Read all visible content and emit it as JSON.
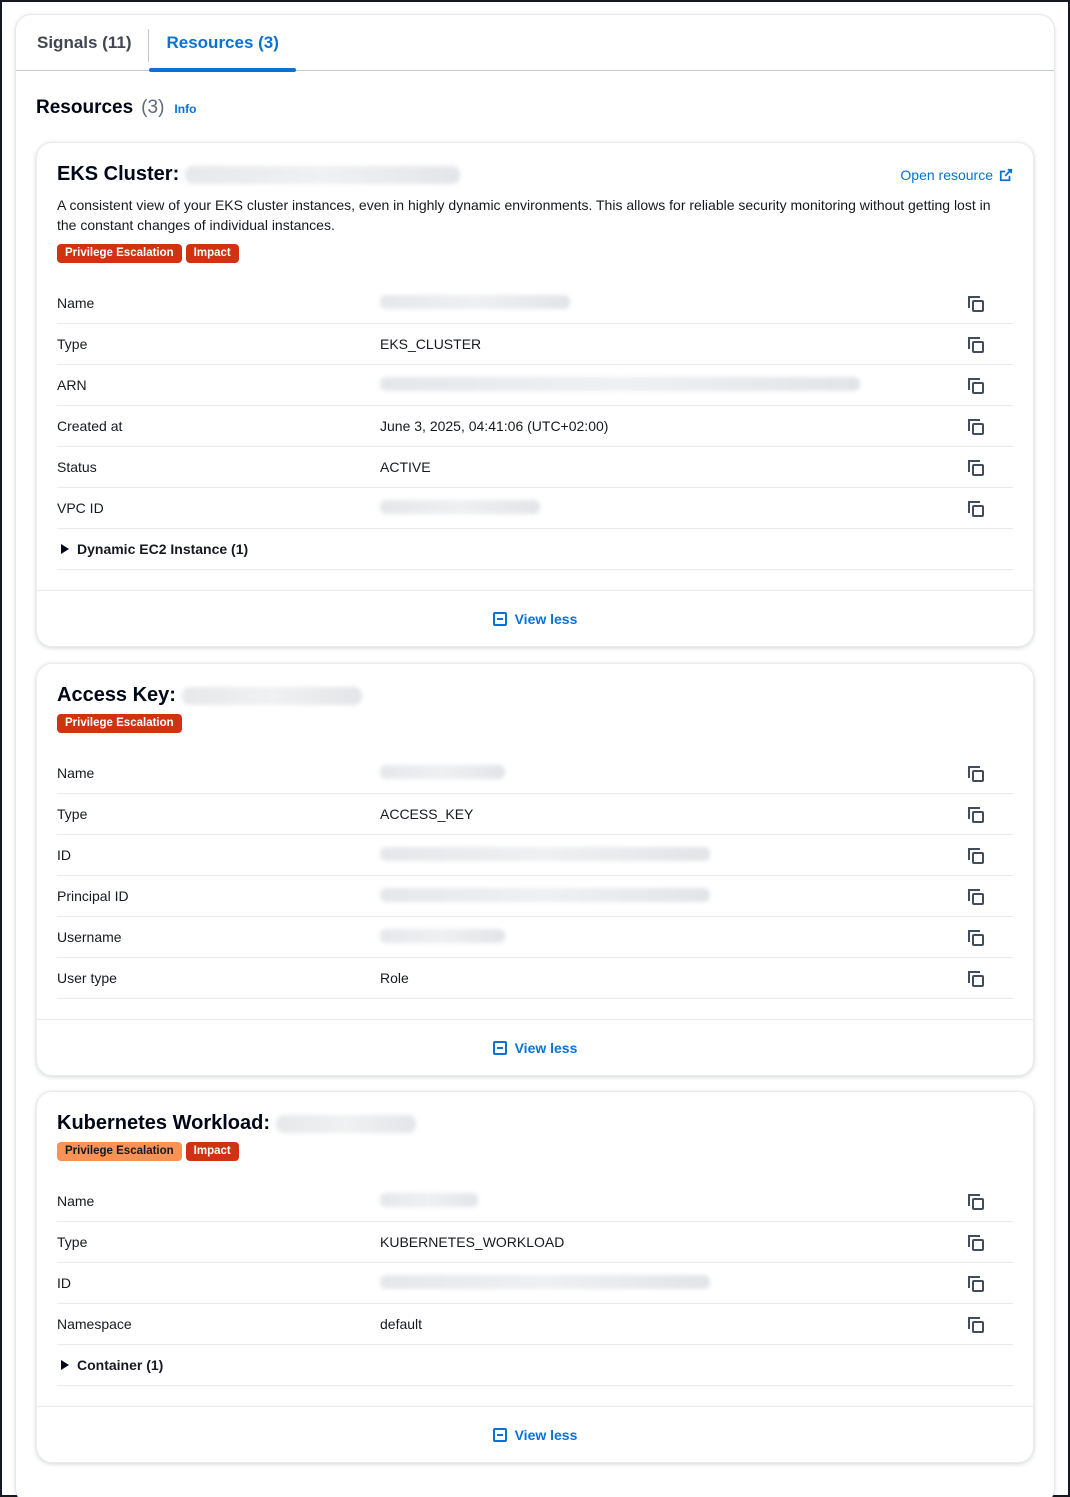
{
  "tabs": [
    {
      "label": "Signals (11)"
    },
    {
      "label": "Resources (3)"
    }
  ],
  "section": {
    "title": "Resources",
    "count": "(3)",
    "info": "Info"
  },
  "resources": [
    {
      "title": "EKS Cluster:",
      "open_link": "Open resource",
      "description": "A consistent view of your EKS cluster instances, even in highly dynamic environments. This allows for reliable security monitoring without getting lost in the constant changes of individual instances.",
      "badges": [
        "Privilege Escalation",
        "Impact"
      ],
      "fields": [
        {
          "key": "Name",
          "value": ""
        },
        {
          "key": "Type",
          "value": "EKS_CLUSTER"
        },
        {
          "key": "ARN",
          "value": ""
        },
        {
          "key": "Created at",
          "value": "June 3, 2025, 04:41:06 (UTC+02:00)"
        },
        {
          "key": "Status",
          "value": "ACTIVE"
        },
        {
          "key": "VPC ID",
          "value": ""
        }
      ],
      "expander": "Dynamic EC2 Instance (1)",
      "footer": "View less"
    },
    {
      "title": "Access Key:",
      "badges": [
        "Privilege Escalation"
      ],
      "fields": [
        {
          "key": "Name",
          "value": ""
        },
        {
          "key": "Type",
          "value": "ACCESS_KEY"
        },
        {
          "key": "ID",
          "value": ""
        },
        {
          "key": "Principal ID",
          "value": ""
        },
        {
          "key": "Username",
          "value": ""
        },
        {
          "key": "User type",
          "value": "Role"
        }
      ],
      "footer": "View less"
    },
    {
      "title": "Kubernetes Workload:",
      "badges": [
        "Privilege Escalation",
        "Impact"
      ],
      "fields": [
        {
          "key": "Name",
          "value": ""
        },
        {
          "key": "Type",
          "value": "KUBERNETES_WORKLOAD"
        },
        {
          "key": "ID",
          "value": ""
        },
        {
          "key": "Namespace",
          "value": "default"
        }
      ],
      "expander": "Container (1)",
      "footer": "View less"
    }
  ],
  "colors": {
    "accent": "#0972d3",
    "badge_red": "#d13212",
    "badge_orange": "#f89256"
  },
  "icons": {
    "copy": "copy-icon",
    "external": "external-link-icon",
    "collapse": "collapse-icon",
    "caret": "caret-right-icon"
  }
}
